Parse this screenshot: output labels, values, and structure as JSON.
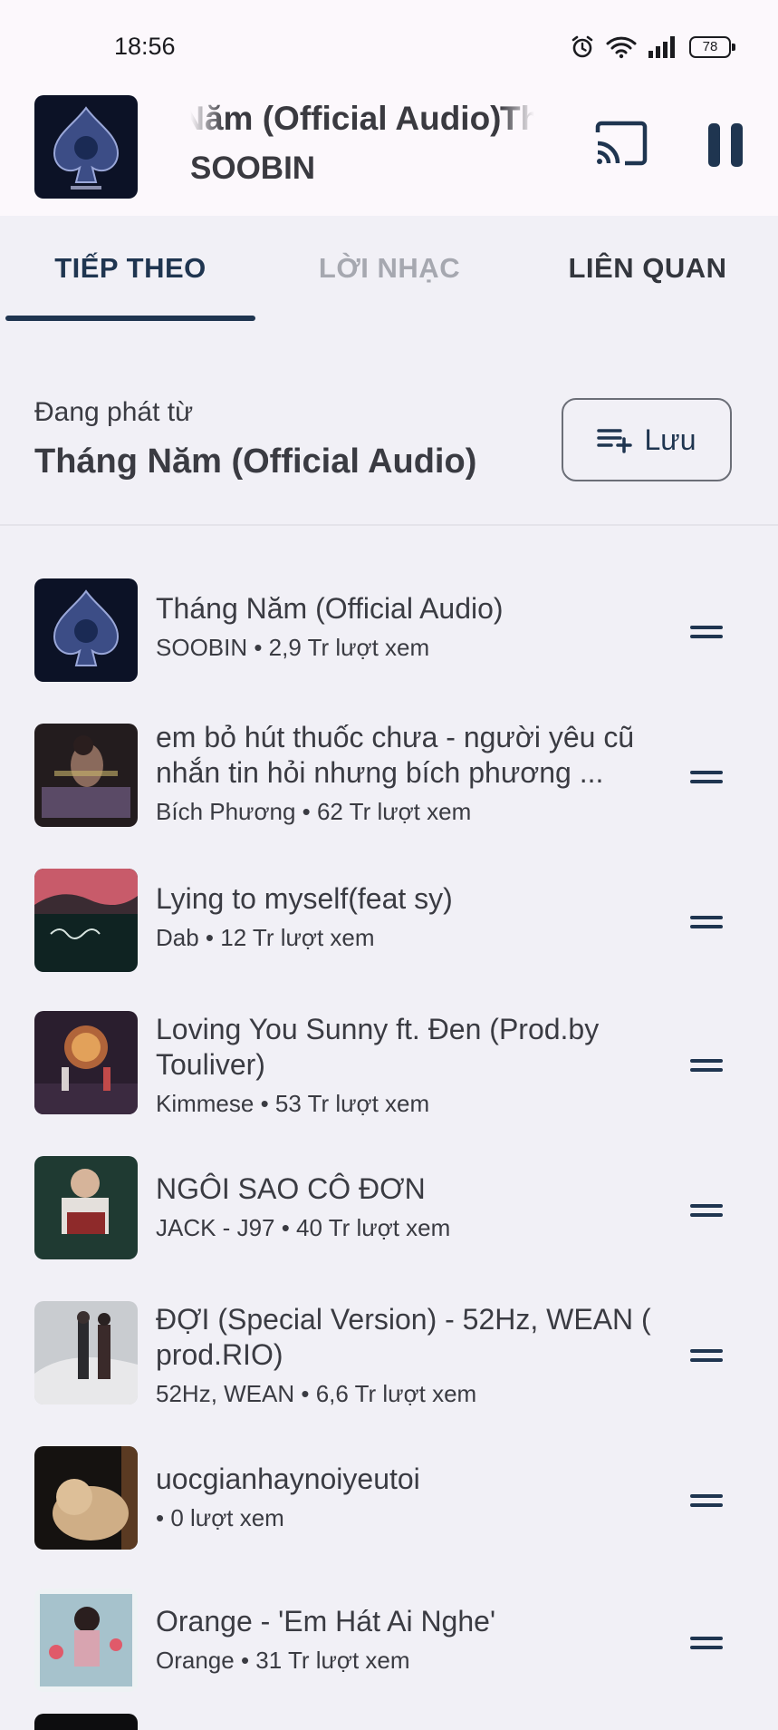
{
  "status_bar": {
    "time": "18:56",
    "battery": "78"
  },
  "mini_player": {
    "title": "Tháng Năm (Official Audio)",
    "artist": "SOOBIN",
    "icons": {
      "cast": "cast-icon",
      "pause": "pause-icon"
    }
  },
  "tabs": [
    {
      "label": "TIẾP THEO",
      "active": true
    },
    {
      "label": "LỜI NHẠC",
      "active": false
    },
    {
      "label": "LIÊN QUAN",
      "active": false
    }
  ],
  "source": {
    "label": "Đang phát từ",
    "title": "Tháng Năm (Official Audio)",
    "save_label": "Lưu",
    "save_icon": "playlist-add-icon"
  },
  "queue": [
    {
      "title": "Tháng Năm (Official Audio)",
      "subtitle": "SOOBIN • 2,9 Tr lượt xem"
    },
    {
      "title": "em bỏ hút thuốc chưa - người yêu cũ nhắn tin hỏi nhưng bích phương ...",
      "subtitle": "Bích Phương • 62 Tr lượt xem"
    },
    {
      "title": "Lying to myself(feat sy)",
      "subtitle": "Dab • 12 Tr lượt xem"
    },
    {
      "title": "Loving You Sunny ft. Đen (Prod.by Touliver)",
      "subtitle": "Kimmese • 53 Tr lượt xem"
    },
    {
      "title": "NGÔI SAO CÔ ĐƠN",
      "subtitle": "JACK - J97 • 40 Tr lượt xem"
    },
    {
      "title": "ĐỢI (Special Version) - 52Hz, WEAN ( prod.RIO)",
      "subtitle": "52Hz, WEAN • 6,6 Tr lượt xem"
    },
    {
      "title": "uocgianhaynoiyeutoi",
      "subtitle": " • 0 lượt xem"
    },
    {
      "title": "Orange - 'Em Hát Ai Nghe'",
      "subtitle": "Orange • 31 Tr lượt xem"
    }
  ]
}
